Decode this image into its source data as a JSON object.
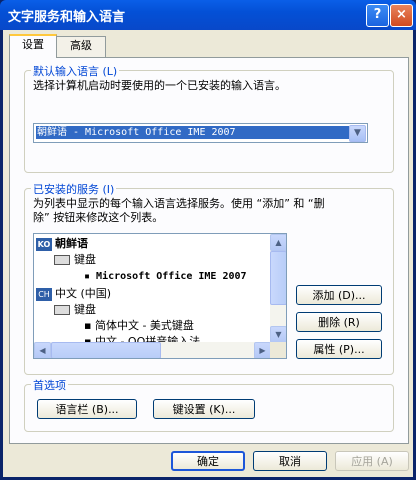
{
  "window": {
    "title": "文字服务和输入语言",
    "help_glyph": "?",
    "close_glyph": "×"
  },
  "tabs": [
    {
      "label": "设置"
    },
    {
      "label": "高级"
    }
  ],
  "default_language": {
    "title": "默认输入语言 (L)",
    "description": "选择计算机启动时要使用的一个已安装的输入语言。",
    "selected": "朝鲜语 - Microsoft Office IME 2007"
  },
  "installed_services": {
    "title": "已安装的服务 (I)",
    "description_line1": "为列表中显示的每个输入语言选择服务。使用 “添加” 和 “删",
    "description_line2": "除” 按钮来修改这个列表。",
    "tree": {
      "korean": {
        "badge": "KO",
        "label": "朝鲜语"
      },
      "korean_kbd": {
        "label": "键盘"
      },
      "korean_ime": {
        "label": "Microsoft Office IME 2007"
      },
      "chinese": {
        "badge": "CH",
        "label": "中文 (中国)"
      },
      "chinese_kbd": {
        "label": "键盘"
      },
      "chinese_ime1": {
        "label": "简体中文 - 美式键盘"
      },
      "chinese_ime2": {
        "label": "中文 - QQ拼音输入法"
      }
    },
    "buttons": {
      "add": "添加 (D)...",
      "remove": "删除 (R)",
      "properties": "属性 (P)..."
    }
  },
  "preferences": {
    "title": "首选项",
    "language_bar": "语言栏 (B)...",
    "key_settings": "键设置 (K)..."
  },
  "footer": {
    "ok": "确定",
    "cancel": "取消",
    "apply": "应用 (A)"
  }
}
